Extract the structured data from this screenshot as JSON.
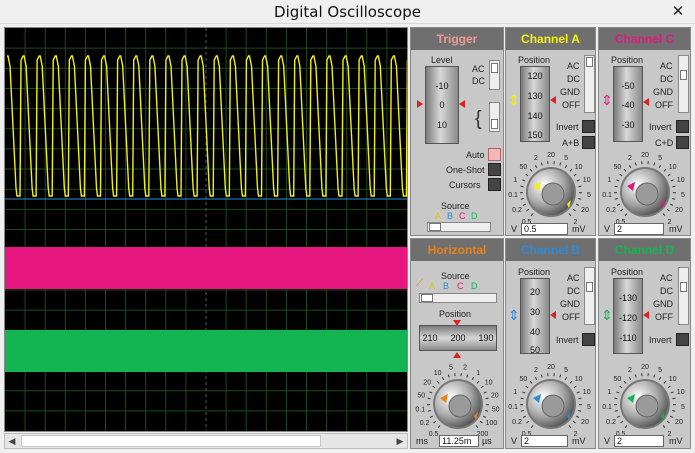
{
  "window": {
    "title": "Digital Oscilloscope"
  },
  "icons": {
    "close": "close-icon"
  },
  "colors": {
    "channel_a": "#f2ef12",
    "channel_b": "#2a8bd8",
    "channel_c": "#e5177f",
    "channel_d": "#12b552",
    "trigger": "#ef9a9a",
    "horizontal": "#e8831c"
  },
  "trigger": {
    "title": "Trigger",
    "level_label": "Level",
    "level_scale": [
      "-10",
      "0",
      "10"
    ],
    "ac_label": "AC",
    "dc_label": "DC",
    "auto_label": "Auto",
    "oneshot_label": "One-Shot",
    "cursors_label": "Cursors",
    "source_label": "Source",
    "source_letters": [
      "A",
      "B",
      "C",
      "D"
    ]
  },
  "channel_a": {
    "title": "Channel A",
    "position_label": "Position",
    "position_scale": [
      "120",
      "130",
      "140",
      "150"
    ],
    "ac": "AC",
    "dc": "DC",
    "gnd": "GND",
    "off": "OFF",
    "invert": "Invert",
    "combo": "A+B",
    "dial_ticks": [
      "0.5",
      "0.2",
      "0.1",
      "1",
      "50",
      "2",
      "20",
      "5",
      "10",
      "10",
      "5",
      "20",
      "2"
    ],
    "v_label": "V",
    "value": "0.5",
    "unit": "mV"
  },
  "channel_c": {
    "title": "Channel C",
    "position_label": "Position",
    "position_scale": [
      "-50",
      "-40",
      "-30"
    ],
    "ac": "AC",
    "dc": "DC",
    "gnd": "GND",
    "off": "OFF",
    "invert": "Invert",
    "combo": "C+D",
    "dial_ticks": [
      "0.5",
      "0.2",
      "0.1",
      "1",
      "50",
      "2",
      "20",
      "5",
      "10",
      "10",
      "5",
      "20",
      "2"
    ],
    "v_label": "V",
    "value": "2",
    "unit": "mV"
  },
  "horizontal": {
    "title": "Horizontal",
    "source_label": "Source",
    "source_letters": [
      "A",
      "B",
      "C",
      "D"
    ],
    "position_label": "Position",
    "position_scale": [
      "210",
      "200",
      "190"
    ],
    "dial_ticks": [
      "0.5",
      "0.2",
      "0.1",
      "50",
      "20",
      "10",
      "5",
      "2",
      "1",
      "10",
      "20",
      "50",
      "100",
      "200"
    ],
    "left_unit": "ms",
    "value": "11.25m",
    "unit": "µs"
  },
  "channel_b": {
    "title": "Channel B",
    "position_label": "Position",
    "position_scale": [
      "20",
      "30",
      "40",
      "50"
    ],
    "ac": "AC",
    "dc": "DC",
    "gnd": "GND",
    "off": "OFF",
    "invert": "Invert",
    "dial_ticks": [
      "0.5",
      "0.2",
      "0.1",
      "1",
      "50",
      "2",
      "20",
      "5",
      "10",
      "10",
      "5",
      "20",
      "2"
    ],
    "v_label": "V",
    "value": "2",
    "unit": "mV"
  },
  "channel_d": {
    "title": "Channel D",
    "position_label": "Position",
    "position_scale": [
      "-130",
      "-120",
      "-110"
    ],
    "ac": "AC",
    "dc": "DC",
    "gnd": "GND",
    "off": "OFF",
    "invert": "Invert",
    "dial_ticks": [
      "0.5",
      "0.2",
      "0.1",
      "1",
      "50",
      "2",
      "20",
      "5",
      "10",
      "10",
      "5",
      "20",
      "2"
    ],
    "v_label": "V",
    "value": "2",
    "unit": "mV"
  }
}
